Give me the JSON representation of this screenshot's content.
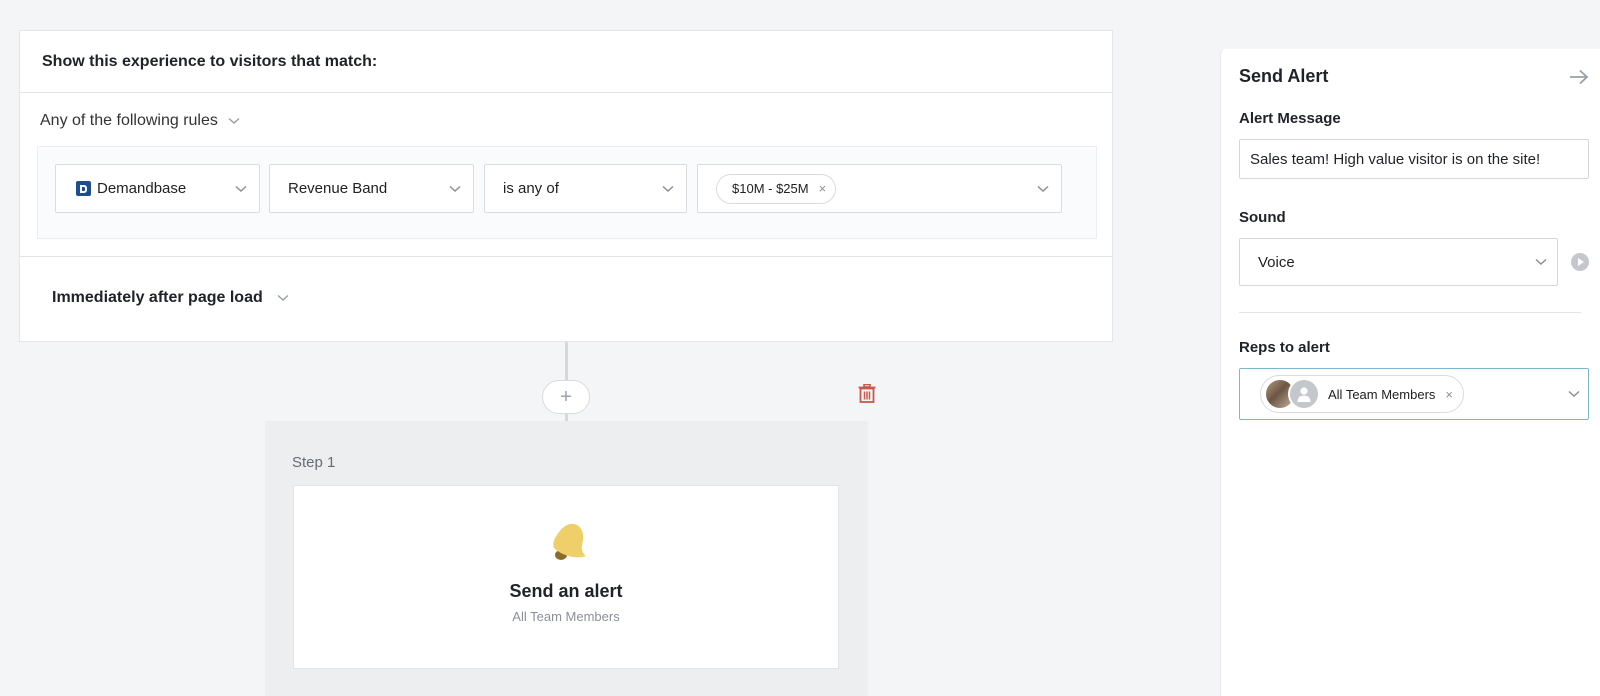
{
  "rules": {
    "header": "Show this experience to visitors that match:",
    "mode": "Any of the following rules",
    "source": "Demandbase",
    "attribute": "Revenue Band",
    "operator": "is any of",
    "values": [
      "$10M - $25M"
    ],
    "tag_remove": "×",
    "trigger": "Immediately after page load"
  },
  "flow": {
    "add_label": "+",
    "step_label": "Step 1",
    "card_title": "Send an alert",
    "card_subtitle": "All Team Members"
  },
  "panel": {
    "title": "Send Alert",
    "alert_message_label": "Alert Message",
    "alert_message_value": "Sales team! High value visitor is on the site!",
    "sound_label": "Sound",
    "sound_value": "Voice",
    "reps_label": "Reps to alert",
    "reps_value": "All Team Members",
    "reps_remove": "×"
  },
  "colors": {
    "bell": "#eecf6a",
    "trash": "#c9584a",
    "brand": "#1c4f8f",
    "focus_border": "#7fb6cf"
  }
}
